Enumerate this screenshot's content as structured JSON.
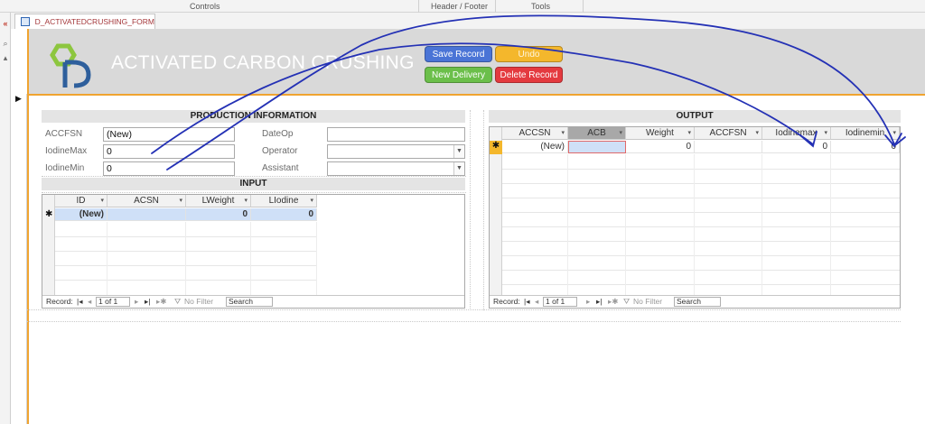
{
  "ribbon": {
    "groups": [
      "Controls",
      "Header / Footer",
      "Tools"
    ]
  },
  "nav_pane": {
    "collapse_glyph": "«",
    "search_glyph": "⌕",
    "scroll_up_glyph": "▴"
  },
  "doc_tab": {
    "title": "D_ACTIVATEDCRUSHING_FORM"
  },
  "header": {
    "title": "ACTIVATED CARBON CRUSHING",
    "buttons": {
      "save": "Save Record",
      "undo": "Undo",
      "new_delivery": "New Delivery",
      "delete": "Delete Record"
    },
    "colors": {
      "save": "#4a74d6",
      "undo": "#f4b72c",
      "new_delivery": "#6bbf4a",
      "delete": "#e43a3f",
      "accent": "#f0a430",
      "logo_green": "#8dc63f",
      "logo_blue": "#2e5f9c"
    }
  },
  "record_selector": {
    "glyph": "▶"
  },
  "production": {
    "heading": "PRODUCTION INFORMATION",
    "fields": {
      "accfsn": {
        "label": "ACCFSN",
        "value": "(New)"
      },
      "iodinemax": {
        "label": "IodineMax",
        "value": "0"
      },
      "iodinemin": {
        "label": "IodineMin",
        "value": "0"
      },
      "dateop": {
        "label": "DateOp",
        "value": ""
      },
      "operator": {
        "label": "Operator",
        "value": ""
      },
      "assistant": {
        "label": "Assistant",
        "value": ""
      }
    }
  },
  "input": {
    "heading": "INPUT",
    "columns": [
      "ID",
      "ACSN",
      "LWeight",
      "LIodine"
    ],
    "new_row": {
      "marker": "✱",
      "cells": [
        "(New)",
        "",
        "0",
        "0"
      ]
    },
    "navigation": {
      "label": "Record:",
      "position": "1 of 1",
      "filter": "No Filter",
      "search": "Search"
    }
  },
  "output": {
    "heading": "OUTPUT",
    "columns": [
      "ACCSN",
      "ACB",
      "Weight",
      "ACCFSN",
      "Iodinemax",
      "Iodinemin"
    ],
    "new_row": {
      "marker": "✱",
      "cells": [
        "(New)",
        "",
        "0",
        "",
        "0",
        "0"
      ]
    },
    "navigation": {
      "label": "Record:",
      "position": "1 of 1",
      "filter": "No Filter",
      "search": "Search"
    }
  }
}
